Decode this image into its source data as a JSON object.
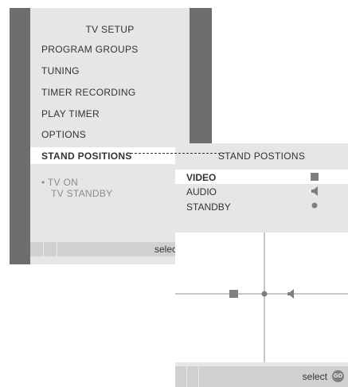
{
  "tv_setup": {
    "title": "TV SETUP",
    "items": [
      "PROGRAM GROUPS",
      "TUNING",
      "TIMER RECORDING",
      "PLAY TIMER",
      "OPTIONS",
      "STAND POSITIONS"
    ],
    "submenu": [
      "• TV ON",
      "TV STANDBY"
    ],
    "footer": "select"
  },
  "stand_positions": {
    "title": "STAND POSTIONS",
    "rows": [
      {
        "label": "VIDEO",
        "icon": "square-icon"
      },
      {
        "label": "AUDIO",
        "icon": "speaker-icon"
      },
      {
        "label": "STANDBY",
        "icon": "dot-icon"
      }
    ],
    "footer": "select",
    "go_label": "GO"
  }
}
